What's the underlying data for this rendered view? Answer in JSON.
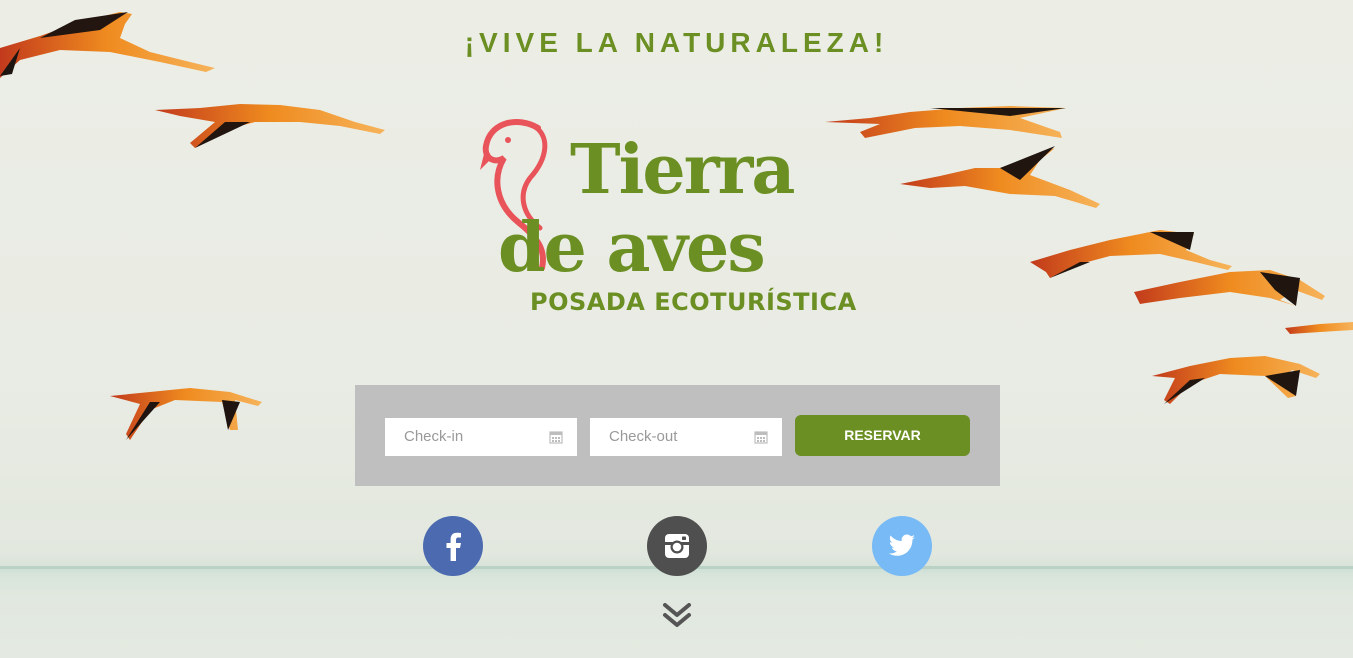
{
  "hero": {
    "tagline": "¡VIVE LA NATURALEZA!"
  },
  "logo": {
    "line1": "Tierra",
    "line2": "de aves",
    "subtitle": "POSADA ECOTURÍSTICA",
    "colors": {
      "green": "#6b8f22",
      "flamingo": "#e8545a"
    },
    "icon": "flamingo-icon"
  },
  "booking": {
    "checkin_placeholder": "Check-in",
    "checkout_placeholder": "Check-out",
    "reserve_label": "RESERVAR",
    "field_icon": "calendar-icon",
    "button_color": "#6b8f22"
  },
  "social": [
    {
      "network": "facebook",
      "icon": "facebook-icon",
      "color": "#4b6aaf"
    },
    {
      "network": "instagram",
      "icon": "instagram-icon",
      "color": "#4f4f4f"
    },
    {
      "network": "twitter",
      "icon": "twitter-icon",
      "color": "#77baf5"
    }
  ],
  "scroll_hint_icon": "double-chevron-down-icon"
}
